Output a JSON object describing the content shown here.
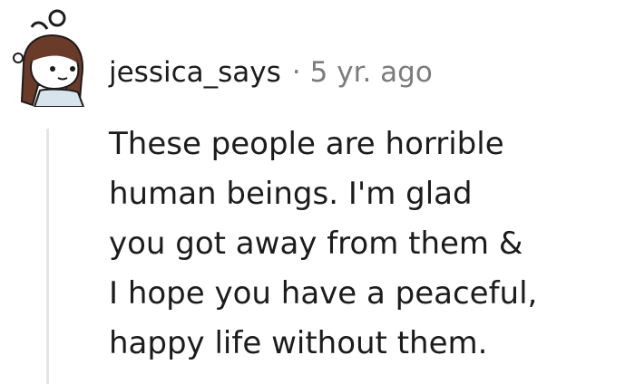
{
  "comment": {
    "username": "jessica_says",
    "separator": "·",
    "age": "5 yr. ago",
    "text": "These people are horrible\nhuman beings. I'm glad\nyou got away from them &\nI hope you have a peaceful,\nhappy life without them."
  },
  "avatar": {
    "hair_color": "#6b3b2a",
    "skin_color": "#ffffff",
    "shirt_color": "#d8e4ec"
  }
}
